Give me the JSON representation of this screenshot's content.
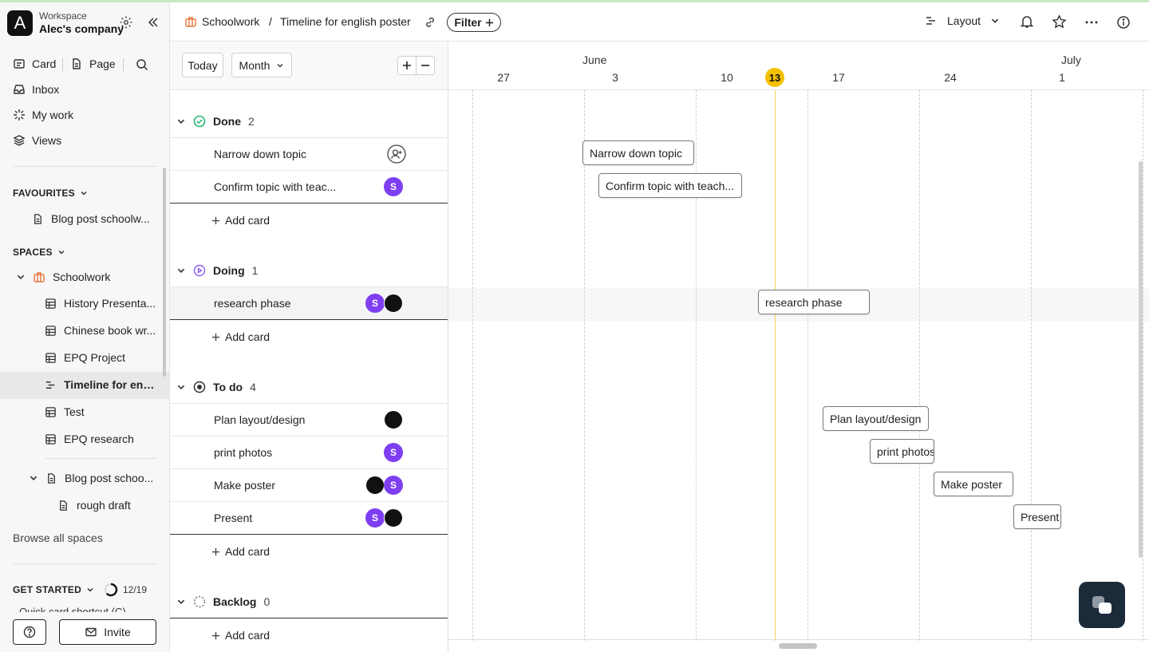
{
  "workspace": {
    "label": "Workspace",
    "name": "Alec's company",
    "logo_letter": "A"
  },
  "sidebar": {
    "top_actions": {
      "card": "Card",
      "page": "Page"
    },
    "nav": [
      {
        "label": "Inbox",
        "icon": "inbox-icon"
      },
      {
        "label": "My work",
        "icon": "sparkle-icon"
      },
      {
        "label": "Views",
        "icon": "layers-icon"
      }
    ],
    "favourites_title": "FAVOURITES",
    "favourites": [
      {
        "label": "Blog post schoolw..."
      }
    ],
    "spaces_title": "SPACES",
    "space": {
      "label": "Schoolwork"
    },
    "space_items": [
      {
        "label": "History Presenta...",
        "icon": "table-icon"
      },
      {
        "label": "Chinese book wr...",
        "icon": "table-icon"
      },
      {
        "label": "EPQ Project",
        "icon": "table-icon"
      },
      {
        "label": "Timeline for eng...",
        "icon": "timeline-icon",
        "active": true
      },
      {
        "label": "Test",
        "icon": "table-icon"
      },
      {
        "label": "EPQ research",
        "icon": "table-icon"
      }
    ],
    "blog_item": {
      "label": "Blog post schoo..."
    },
    "blog_child": {
      "label": "rough draft"
    },
    "browse_all": "Browse all spaces",
    "get_started": {
      "title": "GET STARTED",
      "progress_text": "12/19",
      "progress_value": 0.63
    },
    "quick_card": "Quick card shortcut (C)",
    "invite": "Invite"
  },
  "header": {
    "breadcrumb_space": "Schoolwork",
    "breadcrumb_sep": "/",
    "breadcrumb_page": "Timeline for english poster",
    "filter": "Filter",
    "layout": "Layout"
  },
  "toolbar": {
    "today": "Today",
    "range": "Month"
  },
  "groups": [
    {
      "name": "Done",
      "count": "2",
      "icon": "check-circle-icon",
      "cards": [
        {
          "title": "Narrow down topic",
          "assignees": []
        },
        {
          "title": "Confirm topic with teac...",
          "assignees": [
            "S"
          ]
        }
      ]
    },
    {
      "name": "Doing",
      "count": "1",
      "icon": "play-circle-icon",
      "cards": [
        {
          "title": "research phase",
          "assignees": [
            "S",
            ""
          ]
        }
      ]
    },
    {
      "name": "To do",
      "count": "4",
      "icon": "target-icon",
      "cards": [
        {
          "title": "Plan layout/design",
          "assignees": [
            ""
          ]
        },
        {
          "title": "print photos",
          "assignees": [
            "S"
          ]
        },
        {
          "title": "Make poster",
          "assignees": [
            "",
            "S"
          ]
        },
        {
          "title": "Present",
          "assignees": [
            "S",
            ""
          ]
        }
      ]
    },
    {
      "name": "Backlog",
      "count": "0",
      "icon": "dashed-circle-icon",
      "cards": []
    }
  ],
  "add_card": "Add card",
  "timeline": {
    "months": [
      {
        "label": "June"
      },
      {
        "label": "July"
      }
    ],
    "days": [
      "27",
      "3",
      "10",
      "13",
      "17",
      "24",
      "1"
    ],
    "today": "13",
    "bars": [
      {
        "title": "Narrow down topic"
      },
      {
        "title": "Confirm topic with teach..."
      },
      {
        "title": "research phase"
      },
      {
        "title": "Plan layout/design"
      },
      {
        "title": "print photos"
      },
      {
        "title": "Make poster"
      },
      {
        "title": "Present"
      }
    ]
  },
  "colors": {
    "accent_today": "#f5c000",
    "avatar_purple": "#7e3ff2",
    "done_green": "#2bb673",
    "doing_purple": "#8b5cf6",
    "space_orange": "#e8743b"
  }
}
